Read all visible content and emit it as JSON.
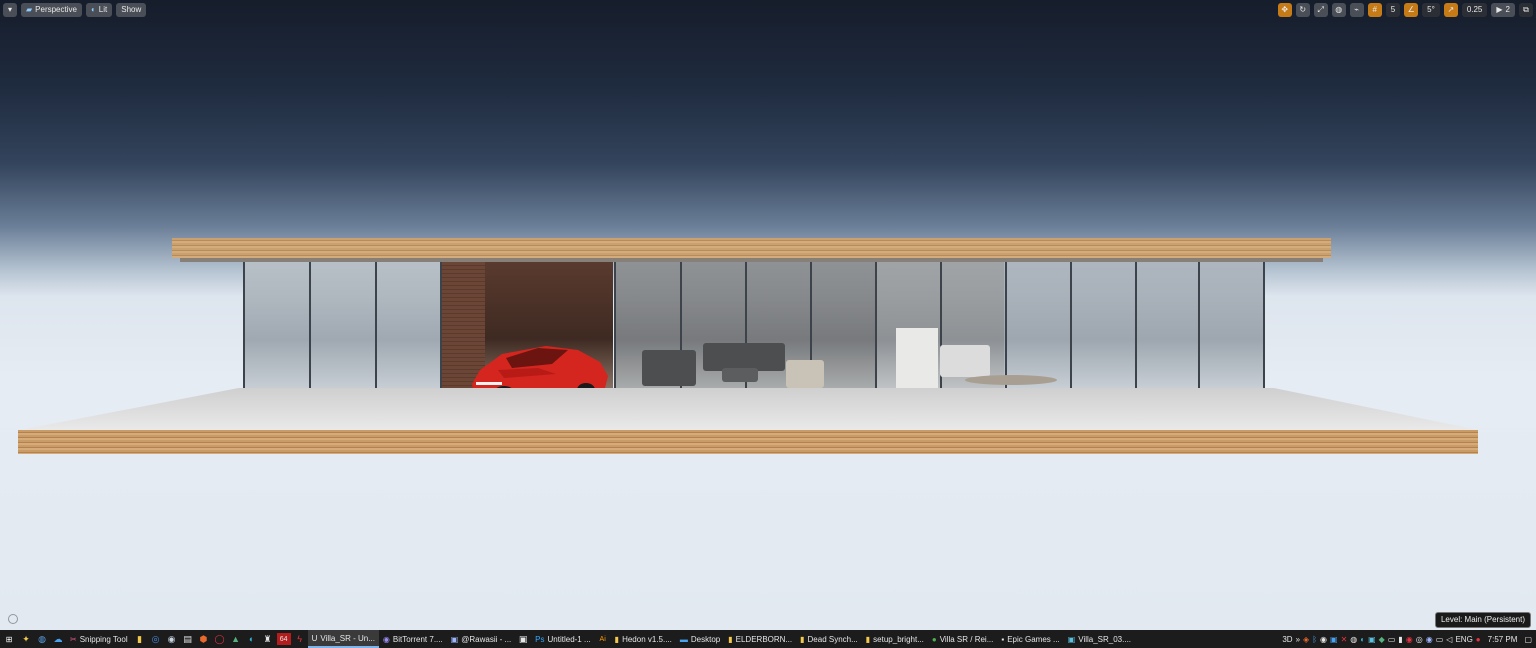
{
  "viewport": {
    "menu_icon": "chevron-down-icon",
    "view_mode": "Perspective",
    "lit_mode": "Lit",
    "show_label": "Show",
    "right_toolbar": {
      "grid_snap": "5",
      "rotation_snap": "5°",
      "scale_snap": "0.25",
      "camera_speed": "2"
    },
    "level_label": "Level:  Main (Persistent)"
  },
  "taskbar": {
    "tasks": [
      {
        "label": "Snipping Tool",
        "glyph": "✂",
        "color": "#e05a8b"
      },
      {
        "label": "Villa_SR - Un...",
        "glyph": "U",
        "color": "#dddddd",
        "active": true
      },
      {
        "label": "BitTorrent 7....",
        "glyph": "◉",
        "color": "#9a8cf0"
      },
      {
        "label": "@Rawasii - ...",
        "glyph": "▣",
        "color": "#9fb6ff"
      },
      {
        "label": "Untitled-1 ...",
        "glyph": "Ps",
        "color": "#31a8ff"
      },
      {
        "label": "Hedon v1.5....",
        "glyph": "▮",
        "color": "#f2c94c"
      },
      {
        "label": "Desktop",
        "glyph": "▬",
        "color": "#4aa3f0"
      },
      {
        "label": "ELDERBORN...",
        "glyph": "▮",
        "color": "#f2c94c"
      },
      {
        "label": "Dead Synch...",
        "glyph": "▮",
        "color": "#f2c94c"
      },
      {
        "label": "setup_bright...",
        "glyph": "▮",
        "color": "#f2c94c"
      },
      {
        "label": "Villa SR / Rei...",
        "glyph": "●",
        "color": "#4caf50"
      },
      {
        "label": "Epic Games ...",
        "glyph": "▪",
        "color": "#dddddd"
      },
      {
        "label": "Villa_SR_03....",
        "glyph": "▣",
        "color": "#5bc0de"
      }
    ],
    "badge_64": "64",
    "tray_3d": "3D",
    "language": "ENG",
    "time": "7:57 PM"
  }
}
